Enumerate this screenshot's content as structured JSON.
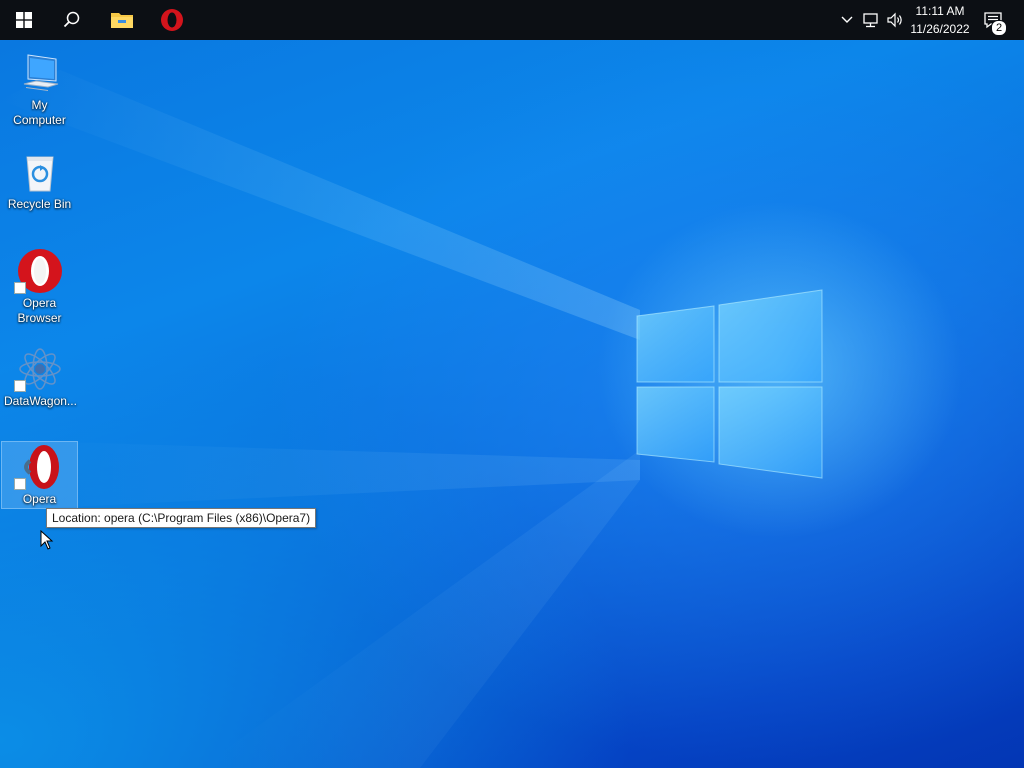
{
  "taskbar": {
    "start_button": "start-icon",
    "search_button": "search-icon",
    "pinned": [
      {
        "name": "file-explorer",
        "icon": "folder-icon"
      },
      {
        "name": "opera",
        "icon": "opera-icon"
      }
    ],
    "tray": {
      "chevron": "chevron-up-icon",
      "network": "network-icon",
      "volume": "volume-icon"
    },
    "clock": {
      "time": "11:11 AM",
      "date": "11/26/2022"
    },
    "notifications": {
      "icon": "action-center-icon",
      "count": "2"
    }
  },
  "desktop": {
    "icons": [
      {
        "label": "My Computer",
        "icon": "computer-icon"
      },
      {
        "label": "Recycle Bin",
        "icon": "recycle-bin-icon"
      },
      {
        "label": "Opera Browser",
        "icon": "opera-icon"
      },
      {
        "label": "DataWagon...",
        "icon": "datawagon-icon"
      },
      {
        "label": "Opera",
        "icon": "opera-icon",
        "selected": true
      }
    ],
    "tooltip": "Location: opera (C:\\Program Files (x86)\\Opera7)"
  },
  "colors": {
    "taskbar": "#0c0f14",
    "wallpaper": "#0a78e0",
    "opera_red": "#d4141c"
  }
}
